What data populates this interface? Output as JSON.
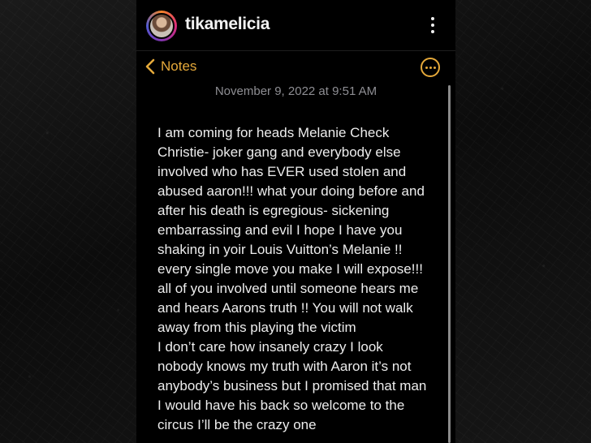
{
  "header": {
    "username": "tikamelicia",
    "avatar_icon": "profile-avatar",
    "menu_icon": "more-vertical-icon"
  },
  "notes_nav": {
    "back_label": "Notes",
    "back_icon": "chevron-left-icon",
    "more_icon": "ellipsis-circle-icon",
    "accent_color": "#e5a93a"
  },
  "note": {
    "date": "November 9, 2022 at 9:51 AM",
    "lines": [
      "I am coming for heads Melanie Check",
      "Christie- joker gang and everybody else",
      "involved who has EVER used stolen and",
      "abused aaron!!! what your doing before and",
      "after his death is egregious- sickening",
      "embarrassing and evil I hope I have you",
      "shaking in yoir Louis Vuitton’s Melanie !!",
      "every single move you make I will expose!!!",
      "all of you involved until someone hears me",
      "and hears Aarons truth !! You will not walk",
      "away from this playing the victim",
      "I don’t care how insanely crazy I look",
      "nobody knows my truth with Aaron it’s not",
      "anybody’s business but I promised that man",
      "I would have his back so welcome to the",
      "circus I’ll be the crazy one"
    ]
  }
}
